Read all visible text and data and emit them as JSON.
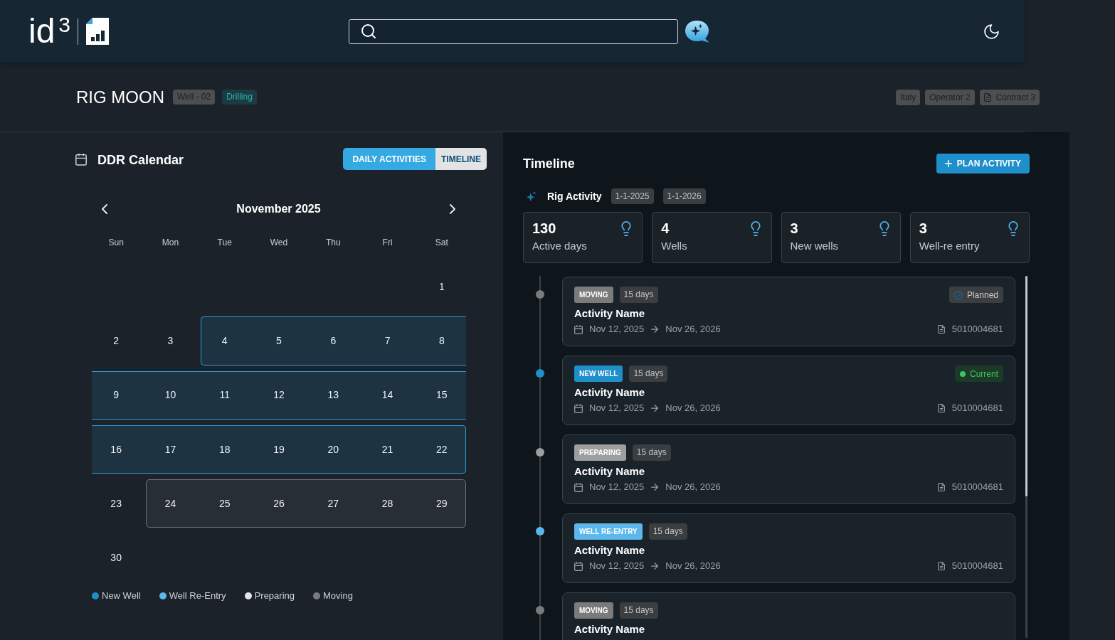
{
  "header": {
    "logo": "id$^{3}$"
  },
  "rig": {
    "title": "RIG MOON",
    "tags": [
      {
        "label": "Well - 02",
        "kind": "neutral"
      },
      {
        "label": "Drilling",
        "kind": "accent"
      }
    ],
    "meta": [
      {
        "label": "Italy",
        "kind": "plain"
      },
      {
        "label": "Operator 2",
        "kind": "plain"
      },
      {
        "label": "Contract 3",
        "kind": "document"
      }
    ]
  },
  "calendar": {
    "title": "DDR Calendar",
    "tabs": [
      {
        "label": "DAILY ACTIVITIES",
        "selected": true
      },
      {
        "label": "TIMELINE",
        "selected": false
      }
    ],
    "month": "November 2025",
    "weekdays": [
      "Sun",
      "Mon",
      "Tue",
      "Wed",
      "Thu",
      "Fri",
      "Sat"
    ],
    "weeks": [
      {
        "segments": [
          {
            "days": [
              {
                "label": "1"
              }
            ]
          }
        ]
      },
      {
        "segments": [
          {
            "days": [
              {
                "label": "2"
              },
              {
                "label": "3"
              }
            ]
          },
          {
            "color": "#2b9fd8",
            "days": [
              {
                "label": "4"
              },
              {
                "label": "5"
              },
              {
                "label": "6"
              },
              {
                "label": "7"
              },
              {
                "label": "8"
              }
            ]
          }
        ]
      },
      {
        "segments": [
          {
            "color": "#2b9fd8",
            "days": [
              {
                "label": "9"
              },
              {
                "label": "10"
              },
              {
                "label": "11"
              },
              {
                "label": "12"
              },
              {
                "label": "13"
              },
              {
                "label": "14"
              },
              {
                "label": "15"
              }
            ]
          }
        ]
      },
      {
        "segments": [
          {
            "color": "#2b9fd8",
            "days": [
              {
                "label": "16"
              },
              {
                "label": "17"
              },
              {
                "label": "18"
              },
              {
                "label": "19"
              },
              {
                "label": "20"
              },
              {
                "label": "21"
              },
              {
                "label": "22"
              }
            ]
          }
        ]
      },
      {
        "segments": [
          {
            "days": [
              {
                "label": "23"
              }
            ]
          },
          {
            "color": "#6e7579",
            "days": [
              {
                "label": "24"
              },
              {
                "label": "25"
              },
              {
                "label": "26"
              },
              {
                "label": "27"
              },
              {
                "label": "28"
              },
              {
                "label": "29"
              }
            ]
          }
        ]
      },
      {
        "segments": [
          {
            "days": [
              {
                "label": "30"
              }
            ]
          }
        ]
      }
    ],
    "legend": [
      {
        "label": "New Well",
        "color": "#1e8fc9"
      },
      {
        "label": "Well Re-Entry",
        "color": "#5bb8ec"
      },
      {
        "label": "Preparing",
        "color": "#e6e6e6"
      },
      {
        "label": "Moving",
        "color": "#7b7b7b"
      }
    ]
  },
  "timeline": {
    "title": "Timeline",
    "action": "PLAN ACTIVITY",
    "summary": {
      "label": "Rig Activity",
      "dates": [
        "1-1-2025",
        "1-1-2026"
      ]
    },
    "stats": [
      {
        "value": "130",
        "label": "Active days"
      },
      {
        "value": "4",
        "label": "Wells"
      },
      {
        "value": "3",
        "label": "New wells"
      },
      {
        "value": "3",
        "label": "Well-re entry"
      }
    ],
    "activities": [
      {
        "type": "MOVING",
        "color": "#7b7b7b",
        "duration": "15 days",
        "status": {
          "label": "Planned",
          "kind": "planned"
        },
        "name": "Activity Name",
        "start": "Nov 12, 2025",
        "end": "Nov 26, 2026",
        "reference": "5010004681"
      },
      {
        "type": "NEW WELL",
        "color": "#1e8fc9",
        "duration": "15 days",
        "status": {
          "label": "Current",
          "kind": "current"
        },
        "name": "Activity Name",
        "start": "Nov 12, 2025",
        "end": "Nov 26, 2026",
        "reference": "5010004681"
      },
      {
        "type": "PREPARING",
        "color": "#9e9e9e",
        "duration": "15 days",
        "name": "Activity Name",
        "start": "Nov 12, 2025",
        "end": "Nov 26, 2026",
        "reference": "5010004681"
      },
      {
        "type": "WELL RE-ENTRY",
        "color": "#5bb8ec",
        "duration": "15 days",
        "name": "Activity Name",
        "start": "Nov 12, 2025",
        "end": "Nov 26, 2026",
        "reference": "5010004681"
      },
      {
        "type": "MOVING",
        "color": "#7b7b7b",
        "duration": "15 days",
        "name": "Activity Name"
      }
    ]
  }
}
